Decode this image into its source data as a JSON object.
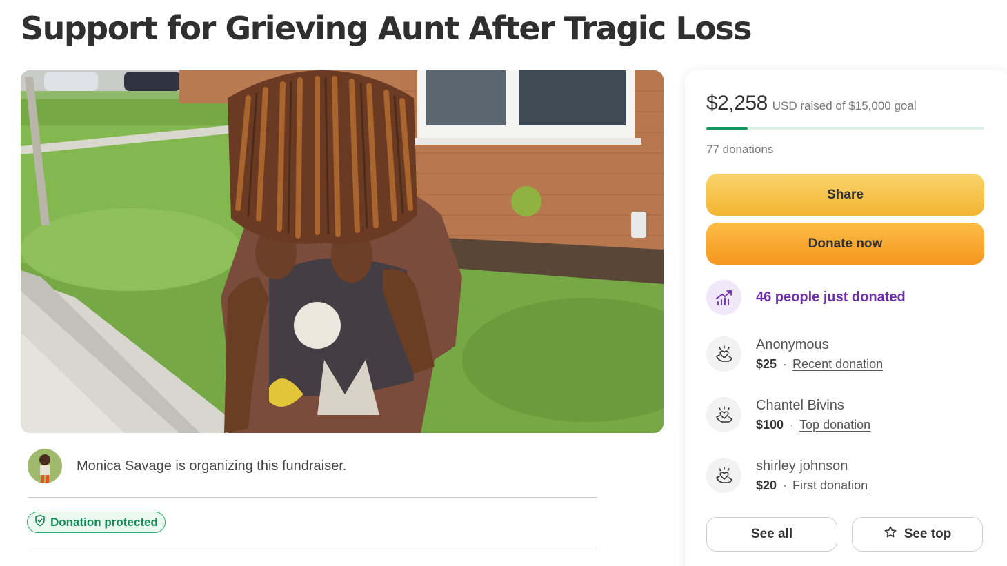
{
  "page": {
    "title": "Support for Grieving Aunt After Tragic Loss"
  },
  "organizer": {
    "text": "Monica Savage is organizing this fundraiser.",
    "avatar_icon": "organizer-avatar"
  },
  "badge": {
    "label": "Donation protected",
    "icon": "shield-check-icon",
    "color": "#148b55"
  },
  "donation_card": {
    "amount": "$2,258",
    "goal_text": "USD raised of $15,000 goal",
    "progress_fraction": 0.15,
    "donation_count": "77 donations",
    "share_label": "Share",
    "donate_label": "Donate now",
    "trending_text": "46 people just donated",
    "trending_icon": "trending-up-icon",
    "donors": [
      {
        "name": "Anonymous",
        "amount": "$25",
        "tag": "Recent donation",
        "icon": "heart-hands-icon"
      },
      {
        "name": "Chantel Bivins",
        "amount": "$100",
        "tag": "Top donation",
        "icon": "heart-hands-icon"
      },
      {
        "name": "shirley johnson",
        "amount": "$20",
        "tag": "First donation",
        "icon": "heart-hands-icon"
      }
    ],
    "see_all_label": "See all",
    "see_top_label": "See top",
    "see_top_icon": "star-icon"
  },
  "colors": {
    "progress": "#13955c",
    "share_button": "#f6c94f",
    "donate_button": "#f7a52a",
    "trending_text": "#6d2eac"
  }
}
